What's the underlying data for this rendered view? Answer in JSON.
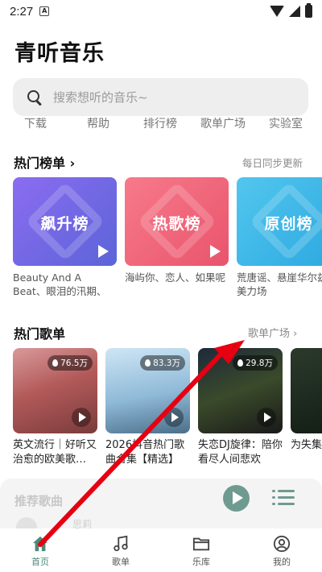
{
  "status_bar": {
    "time": "2:27",
    "sim_icon": "A"
  },
  "app": {
    "title": "青听音乐"
  },
  "search": {
    "placeholder": "搜索想听的音乐~"
  },
  "quick_nav": [
    "下载",
    "帮助",
    "排行榜",
    "歌单广场",
    "实验室"
  ],
  "hot_charts": {
    "title": "热门榜单",
    "more": "每日同步更新",
    "items": [
      {
        "name": "飙升榜",
        "desc": "Beauty And A Beat、眼泪的汛期、单这…",
        "color": "#7a68e0"
      },
      {
        "name": "热歌榜",
        "desc": "海屿你、恋人、如果呢",
        "color": "#f0687e"
      },
      {
        "name": "原创榜",
        "desc": "荒唐谣、悬崖华尔兹、美力场",
        "color": "#3fb7e6"
      }
    ]
  },
  "hot_playlists": {
    "title": "热门歌单",
    "more": "歌单广场 ›",
    "items": [
      {
        "count": "76.5万",
        "title": "英文流行｜好听又治愈的欧美歌…"
      },
      {
        "count": "83.3万",
        "title": "2026抖音热门歌曲合集【精选】"
      },
      {
        "count": "29.8万",
        "title": "失恋DJ旋律：陪你看尽人间悲欢"
      },
      {
        "count": "",
        "title": "为失集团"
      }
    ]
  },
  "player": {
    "label": "推荐歌曲",
    "sub": "思莉"
  },
  "tabs": [
    {
      "label": "首页",
      "active": true
    },
    {
      "label": "歌单",
      "active": false
    },
    {
      "label": "乐库",
      "active": false
    },
    {
      "label": "我的",
      "active": false
    }
  ],
  "colors": {
    "accent": "#4a8a78",
    "player_accent": "#6f9a90",
    "arrow": "#e60012"
  }
}
